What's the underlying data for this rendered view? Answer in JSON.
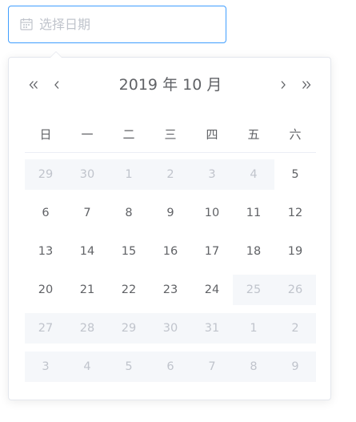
{
  "date_input": {
    "placeholder": "选择日期",
    "icon": "calendar-icon"
  },
  "picker": {
    "header": {
      "label": "2019 年  10 月",
      "prev_year_icon": "double-chevron-left-icon",
      "prev_month_icon": "chevron-left-icon",
      "next_month_icon": "chevron-right-icon",
      "next_year_icon": "double-chevron-right-icon"
    },
    "weekdays": [
      "日",
      "一",
      "二",
      "三",
      "四",
      "五",
      "六"
    ],
    "weeks": [
      [
        {
          "day": "29",
          "disabled": true
        },
        {
          "day": "30",
          "disabled": true
        },
        {
          "day": "1",
          "disabled": true
        },
        {
          "day": "2",
          "disabled": true
        },
        {
          "day": "3",
          "disabled": true
        },
        {
          "day": "4",
          "disabled": true
        },
        {
          "day": "5",
          "disabled": false
        }
      ],
      [
        {
          "day": "6",
          "disabled": false
        },
        {
          "day": "7",
          "disabled": false
        },
        {
          "day": "8",
          "disabled": false
        },
        {
          "day": "9",
          "disabled": false
        },
        {
          "day": "10",
          "disabled": false
        },
        {
          "day": "11",
          "disabled": false
        },
        {
          "day": "12",
          "disabled": false
        }
      ],
      [
        {
          "day": "13",
          "disabled": false
        },
        {
          "day": "14",
          "disabled": false
        },
        {
          "day": "15",
          "disabled": false
        },
        {
          "day": "16",
          "disabled": false
        },
        {
          "day": "17",
          "disabled": false
        },
        {
          "day": "18",
          "disabled": false
        },
        {
          "day": "19",
          "disabled": false
        }
      ],
      [
        {
          "day": "20",
          "disabled": false
        },
        {
          "day": "21",
          "disabled": false
        },
        {
          "day": "22",
          "disabled": false
        },
        {
          "day": "23",
          "disabled": false
        },
        {
          "day": "24",
          "disabled": false
        },
        {
          "day": "25",
          "disabled": true
        },
        {
          "day": "26",
          "disabled": true
        }
      ],
      [
        {
          "day": "27",
          "disabled": true
        },
        {
          "day": "28",
          "disabled": true
        },
        {
          "day": "29",
          "disabled": true
        },
        {
          "day": "30",
          "disabled": true
        },
        {
          "day": "31",
          "disabled": true
        },
        {
          "day": "1",
          "disabled": true
        },
        {
          "day": "2",
          "disabled": true
        }
      ],
      [
        {
          "day": "3",
          "disabled": true
        },
        {
          "day": "4",
          "disabled": true
        },
        {
          "day": "5",
          "disabled": true
        },
        {
          "day": "6",
          "disabled": true
        },
        {
          "day": "7",
          "disabled": true
        },
        {
          "day": "8",
          "disabled": true
        },
        {
          "day": "9",
          "disabled": true
        }
      ]
    ]
  },
  "colors": {
    "input_focus_border": "#409eff",
    "text": "#606266",
    "placeholder": "#c0c4cc",
    "disabled_bg": "#f5f7fa",
    "disabled_text": "#c0c4cc",
    "border": "#e4e7ed"
  }
}
